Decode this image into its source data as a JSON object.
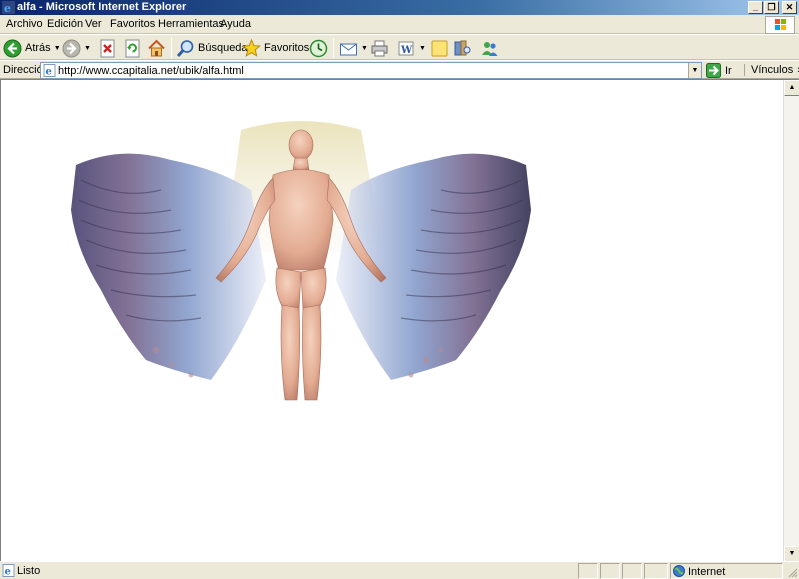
{
  "window": {
    "title": "alfa - Microsoft Internet Explorer",
    "controls": {
      "minimize": "_",
      "maximize": "❐",
      "close": "✕"
    }
  },
  "menu": [
    "Archivo",
    "Edición",
    "Ver",
    "Favoritos",
    "Herramientas",
    "Ayuda"
  ],
  "toolbar": {
    "back_label": "Atrás",
    "search_label": "Búsqueda",
    "favorites_label": "Favoritos"
  },
  "address": {
    "label": "Dirección",
    "url": "http://www.ccapitalia.net/ubik/alfa.html",
    "go_label": "Ir",
    "links_label": "Vínculos",
    "links_more": "»"
  },
  "status": {
    "text": "Listo",
    "zone": "Internet"
  },
  "colors": {
    "titlebar_start": "#0a246a",
    "titlebar_end": "#a6caf0",
    "chrome": "#ece9d8",
    "page_background": "#ffffff"
  },
  "icons": [
    "ie-icon",
    "back-icon",
    "forward-icon",
    "stop-icon",
    "refresh-icon",
    "home-icon",
    "search-icon",
    "favorites-icon",
    "history-icon",
    "mail-icon",
    "print-icon",
    "edit-icon",
    "discuss-icon",
    "research-icon",
    "messenger-icon",
    "go-icon",
    "globe-icon"
  ]
}
